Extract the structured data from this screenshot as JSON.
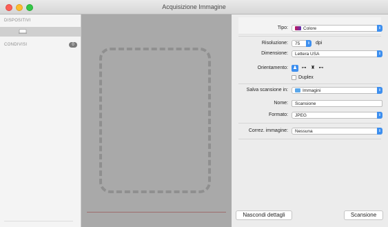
{
  "window": {
    "title": "Acquisizione Immagine"
  },
  "sidebar": {
    "devices_header": "DISPOSITIVI",
    "shared_header": "CONDIVISI",
    "shared_count": "0"
  },
  "settings": {
    "tipo_label": "Tipo:",
    "tipo_value": "Colore",
    "risoluzione_label": "Risoluzione:",
    "risoluzione_value": "75",
    "risoluzione_unit": "dpi",
    "dimensione_label": "Dimensione:",
    "dimensione_value": "Lettera USA",
    "orientamento_label": "Orientamento:",
    "duplex_label": "Duplex",
    "salva_label": "Salva scansione in:",
    "salva_value": "Immagini",
    "nome_label": "Nome:",
    "nome_value": "Scansione",
    "formato_label": "Formato:",
    "formato_value": "JPEG",
    "correz_label": "Correz. immagine:",
    "correz_value": "Nessuna"
  },
  "buttons": {
    "hide_details": "Nascondi dettagli",
    "scan": "Scansione"
  },
  "colors": {
    "accent": "#3d8fef"
  }
}
